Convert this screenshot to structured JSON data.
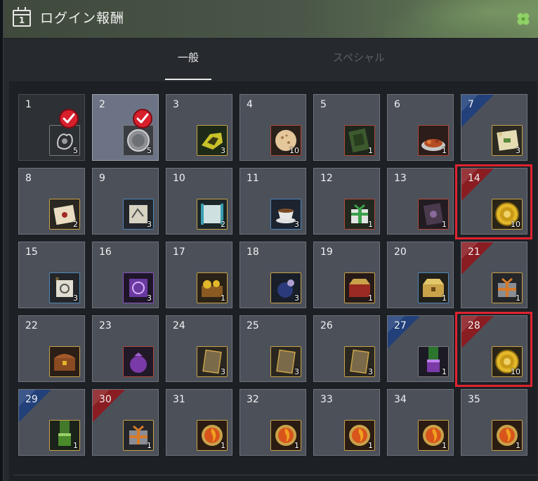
{
  "window": {
    "title": "ログイン報酬",
    "calendar_icon_number": "1"
  },
  "tabs": [
    {
      "label": "一般",
      "active": true
    },
    {
      "label": "スペシャル",
      "active": false
    }
  ],
  "colors": {
    "ribbon_red": "#8a1d22",
    "ribbon_blue": "#22407a",
    "highlight": "#e0232f",
    "check": "#d81f2c"
  },
  "days": [
    {
      "day": "1",
      "item": "ghost-charm-icon",
      "qty": "5",
      "quality": "gray",
      "state": "claimed",
      "ribbon": null
    },
    {
      "day": "2",
      "item": "silver-coin-icon",
      "qty": "5",
      "quality": "gray",
      "state": "today-claimed",
      "ribbon": null
    },
    {
      "day": "3",
      "item": "gold-crystal-icon",
      "qty": "3",
      "quality": "gold",
      "state": "normal",
      "ribbon": null
    },
    {
      "day": "4",
      "item": "cookie-icon",
      "qty": "10",
      "quality": "red",
      "state": "normal",
      "ribbon": null
    },
    {
      "day": "5",
      "item": "green-book-icon",
      "qty": "1",
      "quality": "red",
      "state": "normal",
      "ribbon": null
    },
    {
      "day": "6",
      "item": "food-platter-icon",
      "qty": "1",
      "quality": "red",
      "state": "normal",
      "ribbon": null
    },
    {
      "day": "7",
      "item": "gold-scroll-icon",
      "qty": "3",
      "quality": "gold",
      "state": "normal",
      "ribbon": "blue"
    },
    {
      "day": "8",
      "item": "sealed-letter-icon",
      "qty": "2",
      "quality": "gold",
      "state": "normal",
      "ribbon": null
    },
    {
      "day": "9",
      "item": "map-scroll-icon",
      "qty": "3",
      "quality": "blue",
      "state": "normal",
      "ribbon": null
    },
    {
      "day": "10",
      "item": "teal-map-icon",
      "qty": "2",
      "quality": "gold",
      "state": "normal",
      "ribbon": null
    },
    {
      "day": "11",
      "item": "tea-cup-icon",
      "qty": "3",
      "quality": "blue",
      "state": "normal",
      "ribbon": null
    },
    {
      "day": "12",
      "item": "gift-box-icon",
      "qty": "1",
      "quality": "red",
      "state": "normal",
      "ribbon": null
    },
    {
      "day": "13",
      "item": "dark-tome-icon",
      "qty": "1",
      "quality": "red",
      "state": "normal",
      "ribbon": null
    },
    {
      "day": "14",
      "item": "gold-coin-icon",
      "qty": "10",
      "quality": "gold",
      "state": "normal",
      "ribbon": "red",
      "highlight": true
    },
    {
      "day": "15",
      "item": "p-scroll-icon",
      "qty": "3",
      "quality": "blue",
      "state": "normal",
      "ribbon": null
    },
    {
      "day": "16",
      "item": "purple-rune-icon",
      "qty": "3",
      "quality": "purple",
      "state": "normal",
      "ribbon": null
    },
    {
      "day": "17",
      "item": "treasure-pile-icon",
      "qty": "1",
      "quality": "gold",
      "state": "normal",
      "ribbon": null
    },
    {
      "day": "18",
      "item": "potion-bag-icon",
      "qty": "3",
      "quality": "gold",
      "state": "normal",
      "ribbon": null
    },
    {
      "day": "19",
      "item": "red-chest-icon",
      "qty": "1",
      "quality": "gold",
      "state": "normal",
      "ribbon": null
    },
    {
      "day": "20",
      "item": "gold-chest-icon",
      "qty": "1",
      "quality": "blue",
      "state": "normal",
      "ribbon": null
    },
    {
      "day": "21",
      "item": "silver-gift-icon",
      "qty": "1",
      "quality": "gold",
      "state": "normal",
      "ribbon": "red"
    },
    {
      "day": "22",
      "item": "wooden-chest-icon",
      "qty": "",
      "quality": "gold",
      "state": "normal",
      "ribbon": null
    },
    {
      "day": "23",
      "item": "purple-bag-icon",
      "qty": "",
      "quality": "red",
      "state": "normal",
      "ribbon": null
    },
    {
      "day": "24",
      "item": "card-icon",
      "qty": "3",
      "quality": "gold",
      "state": "normal",
      "ribbon": null
    },
    {
      "day": "25",
      "item": "card-icon",
      "qty": "3",
      "quality": "gold",
      "state": "normal",
      "ribbon": null
    },
    {
      "day": "26",
      "item": "card-icon",
      "qty": "3",
      "quality": "gold",
      "state": "normal",
      "ribbon": null
    },
    {
      "day": "27",
      "item": "purple-cube-icon",
      "qty": "1",
      "quality": "gray",
      "state": "normal",
      "ribbon": "blue"
    },
    {
      "day": "28",
      "item": "gold-coin-icon",
      "qty": "10",
      "quality": "gold",
      "state": "normal",
      "ribbon": "red",
      "highlight": true
    },
    {
      "day": "29",
      "item": "green-cube-icon",
      "qty": "1",
      "quality": "gold",
      "state": "normal",
      "ribbon": "blue"
    },
    {
      "day": "30",
      "item": "silver-gift-icon",
      "qty": "1",
      "quality": "gold",
      "state": "normal",
      "ribbon": "red"
    },
    {
      "day": "31",
      "item": "fire-medal-icon",
      "qty": "1",
      "quality": "gold",
      "state": "normal",
      "ribbon": null
    },
    {
      "day": "32",
      "item": "fire-medal-icon",
      "qty": "1",
      "quality": "gold",
      "state": "normal",
      "ribbon": null
    },
    {
      "day": "33",
      "item": "fire-medal-icon",
      "qty": "1",
      "quality": "gold",
      "state": "normal",
      "ribbon": null
    },
    {
      "day": "34",
      "item": "fire-medal-icon",
      "qty": "1",
      "quality": "gold",
      "state": "normal",
      "ribbon": null
    },
    {
      "day": "35",
      "item": "fire-medal-icon",
      "qty": "1",
      "quality": "gold",
      "state": "normal",
      "ribbon": null
    }
  ]
}
